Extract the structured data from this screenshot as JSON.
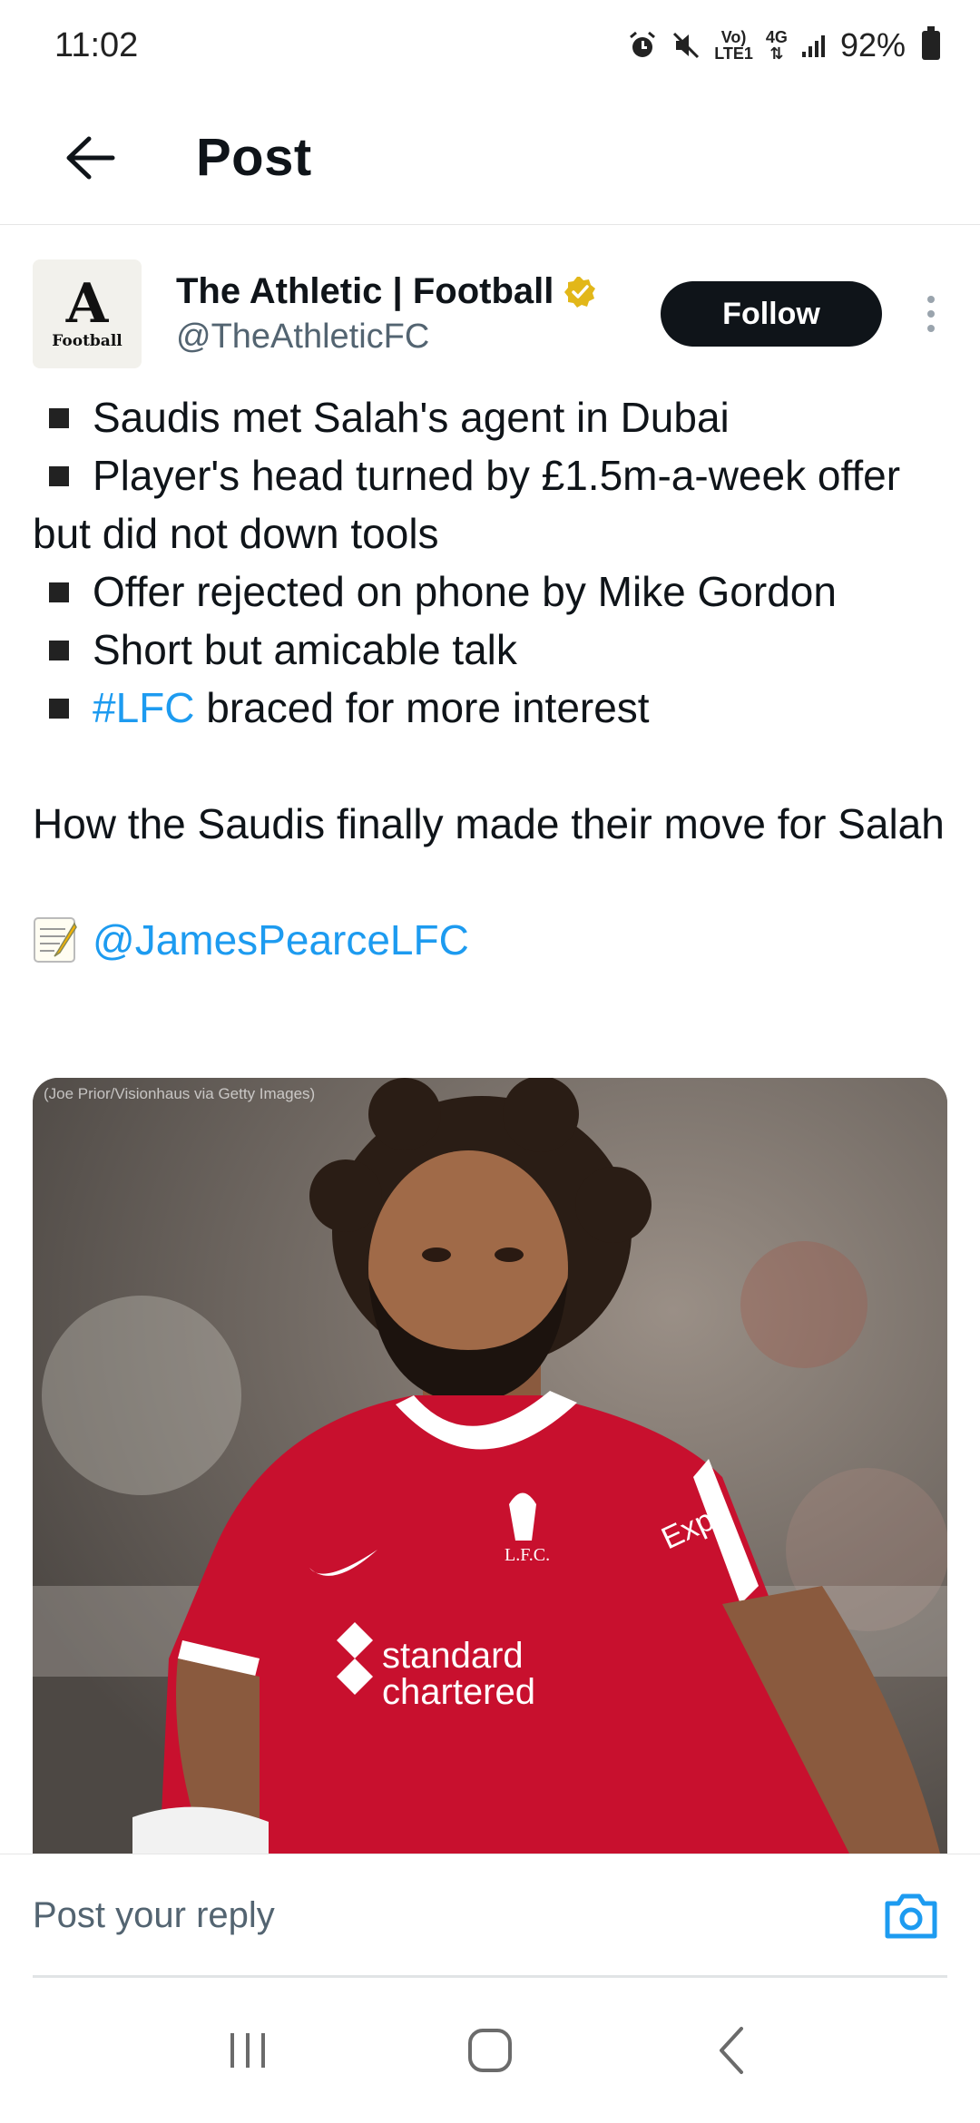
{
  "status_bar": {
    "time": "11:02",
    "network_top": "Vo)",
    "network_bottom": "LTE1",
    "network_type": "4G",
    "battery": "92%"
  },
  "header": {
    "title": "Post"
  },
  "post": {
    "author": {
      "avatar_letter": "A",
      "avatar_text": "Football",
      "display_name": "The Athletic | Football",
      "handle": "@TheAthleticFC",
      "verified_color": "#e2b719"
    },
    "follow_label": "Follow",
    "bullets": {
      "b1": "Saudis met Salah's agent in Dubai",
      "b2": "Player's head turned by £1.5m-a-week offer but did not down tools",
      "b3": "Offer rejected on phone by Mike Gordon",
      "b4": "Short but amicable talk",
      "b5_hashtag": "#LFC",
      "b5_rest": " braced for more interest"
    },
    "headline": "How the Saudis finally made their move for Salah",
    "mention": "@JamesPearceLFC",
    "image": {
      "credit": "(Joe Prior/Visionhaus via Getty Images)",
      "badge_text": "L.F.C.",
      "sponsor_line1": "standard",
      "sponsor_line2": "chartered",
      "sleeve_text": "Exp"
    }
  },
  "reply": {
    "placeholder": "Post your reply"
  },
  "colors": {
    "link": "#1d9bf0",
    "jersey": "#c8102e"
  }
}
